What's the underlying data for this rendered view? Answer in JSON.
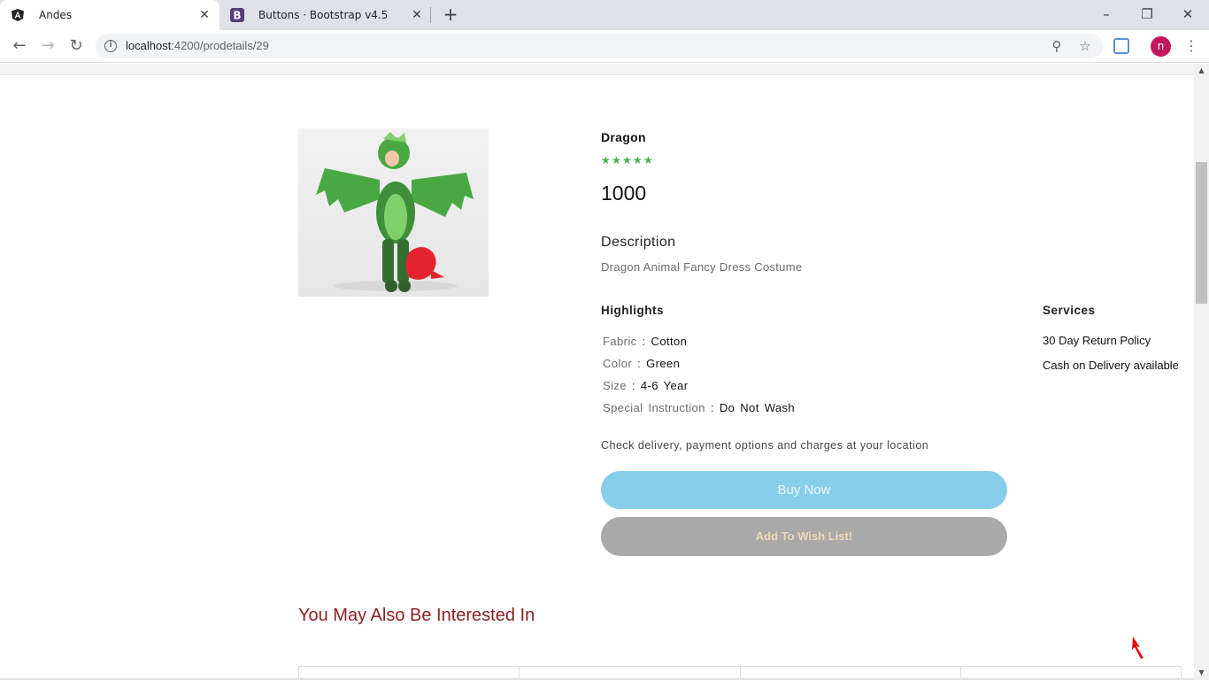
{
  "browser": {
    "tabs": [
      {
        "title": "Andes",
        "icon": "angular-icon",
        "active": true
      },
      {
        "title": "Buttons · Bootstrap v4.5",
        "icon": "bootstrap-icon",
        "active": false
      }
    ],
    "url_host": "localhost",
    "url_rest": ":4200/prodetails/29",
    "profile_initial": "n",
    "colors": {
      "profile": "#c2185b",
      "tab_bar": "#dee1e6"
    }
  },
  "product": {
    "name": "Dragon",
    "rating": 5,
    "price": "1000",
    "description_heading": "Description",
    "description": "Dragon Animal Fancy Dress Costume",
    "highlights_heading": "Highlights",
    "highlights": [
      {
        "key": "Fabric",
        "sep": ":",
        "value": "Cotton"
      },
      {
        "key": "Color",
        "sep": ":",
        "value": "Green"
      },
      {
        "key": "Size",
        "sep": ":",
        "value": "4-6 Year"
      },
      {
        "key": "Special Instruction",
        "sep": ":",
        "value": "Do Not Wash"
      }
    ],
    "services_heading": "Services",
    "services": [
      "30 Day Return Policy",
      "Cash on Delivery available"
    ],
    "delivery_note": "Check delivery, payment options and charges at your location",
    "buy_label": "Buy Now",
    "wishlist_label": "Add To Wish List!"
  },
  "recommendations": {
    "heading": "You May Also Be Interested In",
    "card_count": 4
  },
  "colors": {
    "star": "#3eb34f",
    "buy_button": "#87ceeb",
    "wish_button": "#a9a9a9",
    "interest_heading": "#8b2020"
  }
}
